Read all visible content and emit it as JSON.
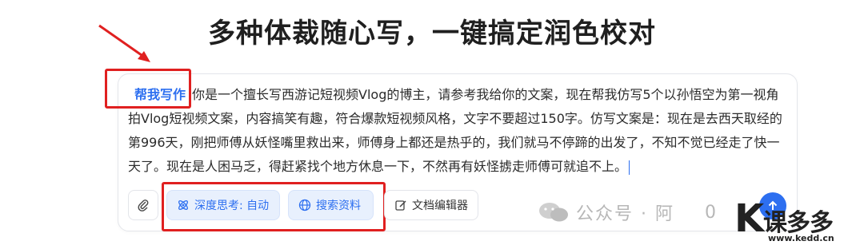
{
  "headline": "多种体裁随心写，一键搞定润色校对",
  "prompt": {
    "tag": "帮我写作",
    "text": "你是一个擅长写西游记短视频Vlog的博主，请参考我给你的文案，现在帮我仿写5个以孙悟空为第一视角拍Vlog短视频文案，内容搞笑有趣，符合爆款短视频风格，文字不要超过150字。仿写文案是：现在是去西天取经的第996天，刚把师傅从妖怪嘴里救出来，师傅身上都还是热乎的，我们就马不停蹄的出发了，不知不觉已经走了快一天了。现在是人困马乏，得赶紧找个地方休息一下，不然再有妖怪掳走师傅可就追不上。"
  },
  "toolbar": {
    "deep_think": "深度思考: 自动",
    "search": "搜索资料",
    "doc_editor": "文档编辑器"
  },
  "watermark": {
    "text": "公众号 · 阿",
    "partial": "0"
  },
  "logo": {
    "letter": "K",
    "cn": "课多多",
    "url": "www.kedd.cn"
  },
  "colors": {
    "accent": "#2d6ff0",
    "highlight_red": "#e02020"
  }
}
